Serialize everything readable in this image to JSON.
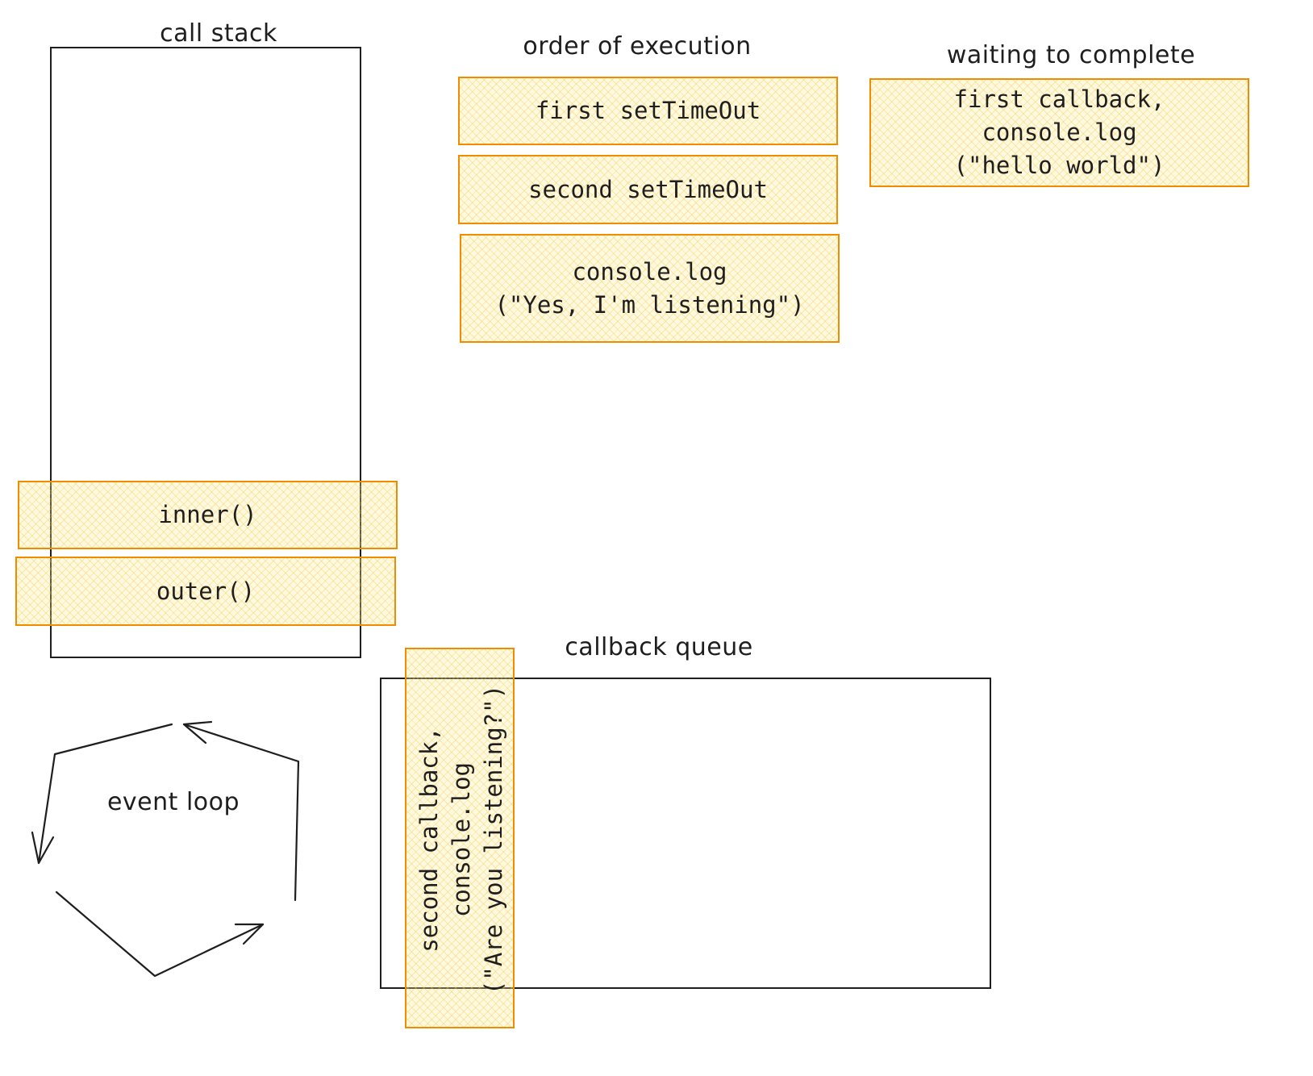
{
  "labels": {
    "call_stack": "call stack",
    "order_of_execution": "order of execution",
    "waiting_to_complete": "waiting to complete",
    "callback_queue": "callback queue",
    "event_loop": "event loop"
  },
  "call_stack_frames": [
    "inner()",
    "outer()"
  ],
  "order_of_execution_items": [
    "first setTimeOut",
    "second setTimeOut",
    "console.log\n(\"Yes, I'm listening\")"
  ],
  "waiting_items": [
    "first callback,\nconsole.log\n(\"hello world\")"
  ],
  "callback_queue_items": [
    "second callback,\nconsole.log\n(\"Are you listening?\")"
  ],
  "colors": {
    "stroke": "#1e1e1e",
    "card_border": "#f08c00",
    "card_fill": "#ffec99"
  }
}
